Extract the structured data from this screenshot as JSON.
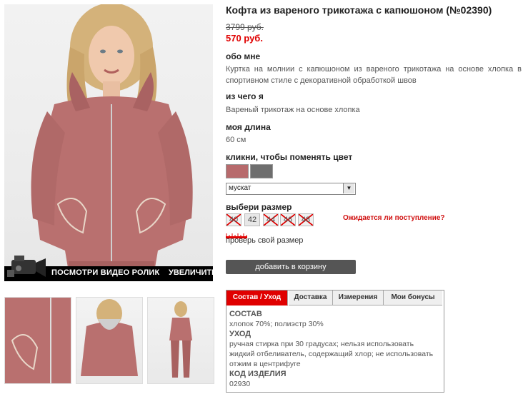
{
  "product": {
    "title": "Кофта из вареного трикотажа с капюшоном (№02390)",
    "old_price": "3799 руб.",
    "new_price": "570 руб."
  },
  "gallery": {
    "video_label": "ПОСМОТРИ ВИДЕО РОЛИК",
    "zoom_label": "УВЕЛИЧИТЬ",
    "camera_icon": "video-camera-icon",
    "garment_color": "#b9706f"
  },
  "about": {
    "heading": "обо мне",
    "text": "Куртка на молнии с капюшоном из вареного трикотажа на основе хлопка в спортивном стиле с декоративной обработкой швов"
  },
  "material": {
    "heading": "из чего я",
    "text": "Вареный трикотаж на основе хлопка"
  },
  "length": {
    "heading": "моя длина",
    "text": "60 см"
  },
  "color": {
    "heading": "кликни, чтобы поменять цвет",
    "swatches": [
      "#b76a6c",
      "#6e6e6e"
    ],
    "selected": "мускат"
  },
  "size": {
    "heading": "выбери размер",
    "options": [
      "40",
      "42",
      "44",
      "46",
      "48"
    ],
    "available": [
      "42"
    ],
    "notify_link": "Ожидается ли поступление?",
    "check_link": "проверь свой размер",
    "ruler_icon": "ruler-icon"
  },
  "cart": {
    "button": "добавить в корзину"
  },
  "tabs": {
    "items": [
      "Состав / Уход",
      "Доставка",
      "Измерения",
      "Мои бонусы"
    ],
    "active_color": "#e00000",
    "panel": {
      "composition_head": "СОСТАВ",
      "composition": "хлопок 70%; полиэстр 30%",
      "care_head": "УХОД",
      "care": "ручная стирка при 30 градусах; нельзя использовать жидкий отбеливатель, содержащий хлор; не использовать отжим в центрифуге",
      "code_head": "КОД ИЗДЕЛИЯ",
      "code": "02930"
    }
  }
}
